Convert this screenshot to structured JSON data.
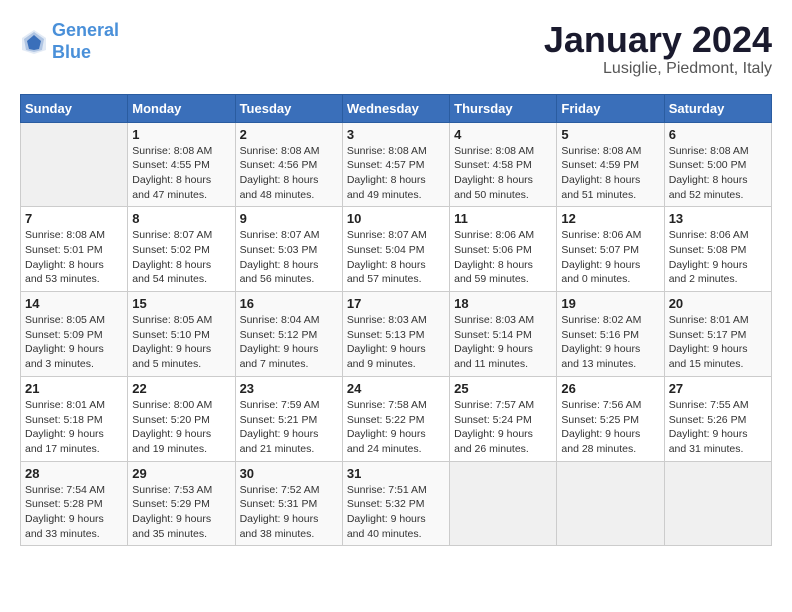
{
  "header": {
    "logo_general": "General",
    "logo_blue": "Blue",
    "month": "January 2024",
    "location": "Lusiglie, Piedmont, Italy"
  },
  "weekdays": [
    "Sunday",
    "Monday",
    "Tuesday",
    "Wednesday",
    "Thursday",
    "Friday",
    "Saturday"
  ],
  "weeks": [
    [
      {
        "day": "",
        "sunrise": "",
        "sunset": "",
        "daylight": ""
      },
      {
        "day": "1",
        "sunrise": "Sunrise: 8:08 AM",
        "sunset": "Sunset: 4:55 PM",
        "daylight": "Daylight: 8 hours and 47 minutes."
      },
      {
        "day": "2",
        "sunrise": "Sunrise: 8:08 AM",
        "sunset": "Sunset: 4:56 PM",
        "daylight": "Daylight: 8 hours and 48 minutes."
      },
      {
        "day": "3",
        "sunrise": "Sunrise: 8:08 AM",
        "sunset": "Sunset: 4:57 PM",
        "daylight": "Daylight: 8 hours and 49 minutes."
      },
      {
        "day": "4",
        "sunrise": "Sunrise: 8:08 AM",
        "sunset": "Sunset: 4:58 PM",
        "daylight": "Daylight: 8 hours and 50 minutes."
      },
      {
        "day": "5",
        "sunrise": "Sunrise: 8:08 AM",
        "sunset": "Sunset: 4:59 PM",
        "daylight": "Daylight: 8 hours and 51 minutes."
      },
      {
        "day": "6",
        "sunrise": "Sunrise: 8:08 AM",
        "sunset": "Sunset: 5:00 PM",
        "daylight": "Daylight: 8 hours and 52 minutes."
      }
    ],
    [
      {
        "day": "7",
        "sunrise": "Sunrise: 8:08 AM",
        "sunset": "Sunset: 5:01 PM",
        "daylight": "Daylight: 8 hours and 53 minutes."
      },
      {
        "day": "8",
        "sunrise": "Sunrise: 8:07 AM",
        "sunset": "Sunset: 5:02 PM",
        "daylight": "Daylight: 8 hours and 54 minutes."
      },
      {
        "day": "9",
        "sunrise": "Sunrise: 8:07 AM",
        "sunset": "Sunset: 5:03 PM",
        "daylight": "Daylight: 8 hours and 56 minutes."
      },
      {
        "day": "10",
        "sunrise": "Sunrise: 8:07 AM",
        "sunset": "Sunset: 5:04 PM",
        "daylight": "Daylight: 8 hours and 57 minutes."
      },
      {
        "day": "11",
        "sunrise": "Sunrise: 8:06 AM",
        "sunset": "Sunset: 5:06 PM",
        "daylight": "Daylight: 8 hours and 59 minutes."
      },
      {
        "day": "12",
        "sunrise": "Sunrise: 8:06 AM",
        "sunset": "Sunset: 5:07 PM",
        "daylight": "Daylight: 9 hours and 0 minutes."
      },
      {
        "day": "13",
        "sunrise": "Sunrise: 8:06 AM",
        "sunset": "Sunset: 5:08 PM",
        "daylight": "Daylight: 9 hours and 2 minutes."
      }
    ],
    [
      {
        "day": "14",
        "sunrise": "Sunrise: 8:05 AM",
        "sunset": "Sunset: 5:09 PM",
        "daylight": "Daylight: 9 hours and 3 minutes."
      },
      {
        "day": "15",
        "sunrise": "Sunrise: 8:05 AM",
        "sunset": "Sunset: 5:10 PM",
        "daylight": "Daylight: 9 hours and 5 minutes."
      },
      {
        "day": "16",
        "sunrise": "Sunrise: 8:04 AM",
        "sunset": "Sunset: 5:12 PM",
        "daylight": "Daylight: 9 hours and 7 minutes."
      },
      {
        "day": "17",
        "sunrise": "Sunrise: 8:03 AM",
        "sunset": "Sunset: 5:13 PM",
        "daylight": "Daylight: 9 hours and 9 minutes."
      },
      {
        "day": "18",
        "sunrise": "Sunrise: 8:03 AM",
        "sunset": "Sunset: 5:14 PM",
        "daylight": "Daylight: 9 hours and 11 minutes."
      },
      {
        "day": "19",
        "sunrise": "Sunrise: 8:02 AM",
        "sunset": "Sunset: 5:16 PM",
        "daylight": "Daylight: 9 hours and 13 minutes."
      },
      {
        "day": "20",
        "sunrise": "Sunrise: 8:01 AM",
        "sunset": "Sunset: 5:17 PM",
        "daylight": "Daylight: 9 hours and 15 minutes."
      }
    ],
    [
      {
        "day": "21",
        "sunrise": "Sunrise: 8:01 AM",
        "sunset": "Sunset: 5:18 PM",
        "daylight": "Daylight: 9 hours and 17 minutes."
      },
      {
        "day": "22",
        "sunrise": "Sunrise: 8:00 AM",
        "sunset": "Sunset: 5:20 PM",
        "daylight": "Daylight: 9 hours and 19 minutes."
      },
      {
        "day": "23",
        "sunrise": "Sunrise: 7:59 AM",
        "sunset": "Sunset: 5:21 PM",
        "daylight": "Daylight: 9 hours and 21 minutes."
      },
      {
        "day": "24",
        "sunrise": "Sunrise: 7:58 AM",
        "sunset": "Sunset: 5:22 PM",
        "daylight": "Daylight: 9 hours and 24 minutes."
      },
      {
        "day": "25",
        "sunrise": "Sunrise: 7:57 AM",
        "sunset": "Sunset: 5:24 PM",
        "daylight": "Daylight: 9 hours and 26 minutes."
      },
      {
        "day": "26",
        "sunrise": "Sunrise: 7:56 AM",
        "sunset": "Sunset: 5:25 PM",
        "daylight": "Daylight: 9 hours and 28 minutes."
      },
      {
        "day": "27",
        "sunrise": "Sunrise: 7:55 AM",
        "sunset": "Sunset: 5:26 PM",
        "daylight": "Daylight: 9 hours and 31 minutes."
      }
    ],
    [
      {
        "day": "28",
        "sunrise": "Sunrise: 7:54 AM",
        "sunset": "Sunset: 5:28 PM",
        "daylight": "Daylight: 9 hours and 33 minutes."
      },
      {
        "day": "29",
        "sunrise": "Sunrise: 7:53 AM",
        "sunset": "Sunset: 5:29 PM",
        "daylight": "Daylight: 9 hours and 35 minutes."
      },
      {
        "day": "30",
        "sunrise": "Sunrise: 7:52 AM",
        "sunset": "Sunset: 5:31 PM",
        "daylight": "Daylight: 9 hours and 38 minutes."
      },
      {
        "day": "31",
        "sunrise": "Sunrise: 7:51 AM",
        "sunset": "Sunset: 5:32 PM",
        "daylight": "Daylight: 9 hours and 40 minutes."
      },
      {
        "day": "",
        "sunrise": "",
        "sunset": "",
        "daylight": ""
      },
      {
        "day": "",
        "sunrise": "",
        "sunset": "",
        "daylight": ""
      },
      {
        "day": "",
        "sunrise": "",
        "sunset": "",
        "daylight": ""
      }
    ]
  ]
}
